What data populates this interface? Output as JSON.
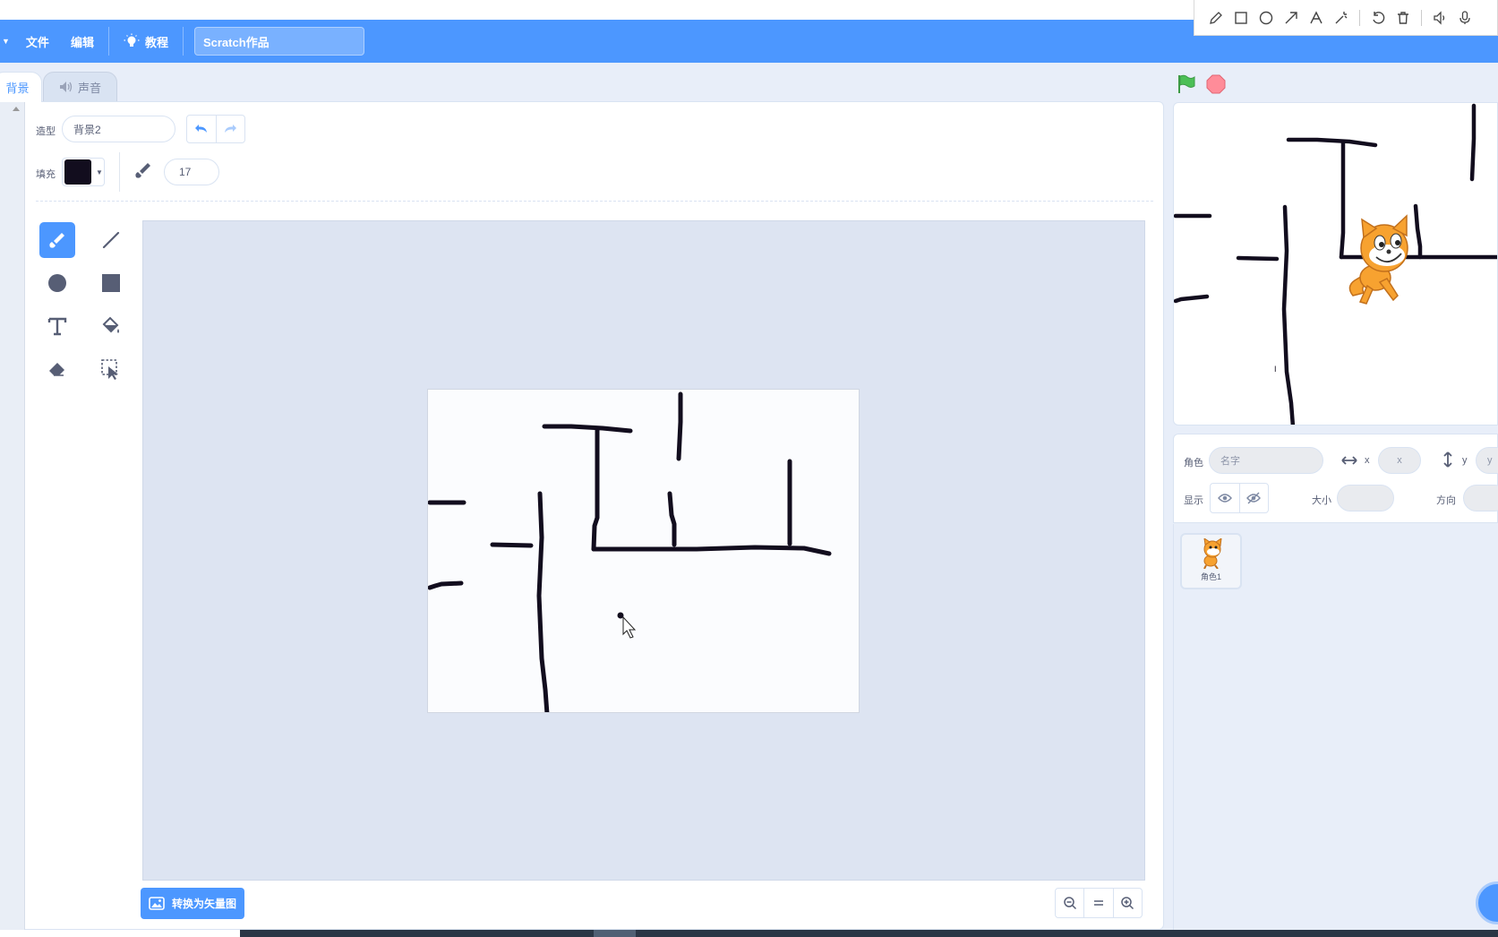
{
  "annotation_toolbar": {
    "icons": [
      "pencil-icon",
      "rectangle-icon",
      "circle-icon",
      "arrow-icon",
      "text-icon",
      "magic-wand-icon",
      "undo-icon",
      "trash-icon",
      "speaker-icon",
      "microphone-icon"
    ]
  },
  "menubar": {
    "file": "文件",
    "edit": "编辑",
    "tutorials": "教程",
    "project_title": "Scratch作品"
  },
  "tabs": {
    "backdrop": "背景",
    "sounds": "声音"
  },
  "paint_editor": {
    "costume_label": "造型",
    "costume_name": "背景2",
    "fill_label": "填充",
    "fill_color": "#120d1e",
    "brush_size": "17",
    "convert_button": "转换为矢量图",
    "active_tool": "brush"
  },
  "sprite_info": {
    "sprite_label": "角色",
    "name_placeholder": "名字",
    "x_label": "x",
    "x_placeholder": "x",
    "y_label": "y",
    "y_placeholder": "y",
    "show_label": "显示",
    "size_label": "大小",
    "direction_label": "方向"
  },
  "sprites": [
    {
      "name": "角色1"
    }
  ],
  "colors": {
    "accent": "#4c97ff",
    "stop": "#ff6680",
    "flag": "#4cbf56"
  }
}
